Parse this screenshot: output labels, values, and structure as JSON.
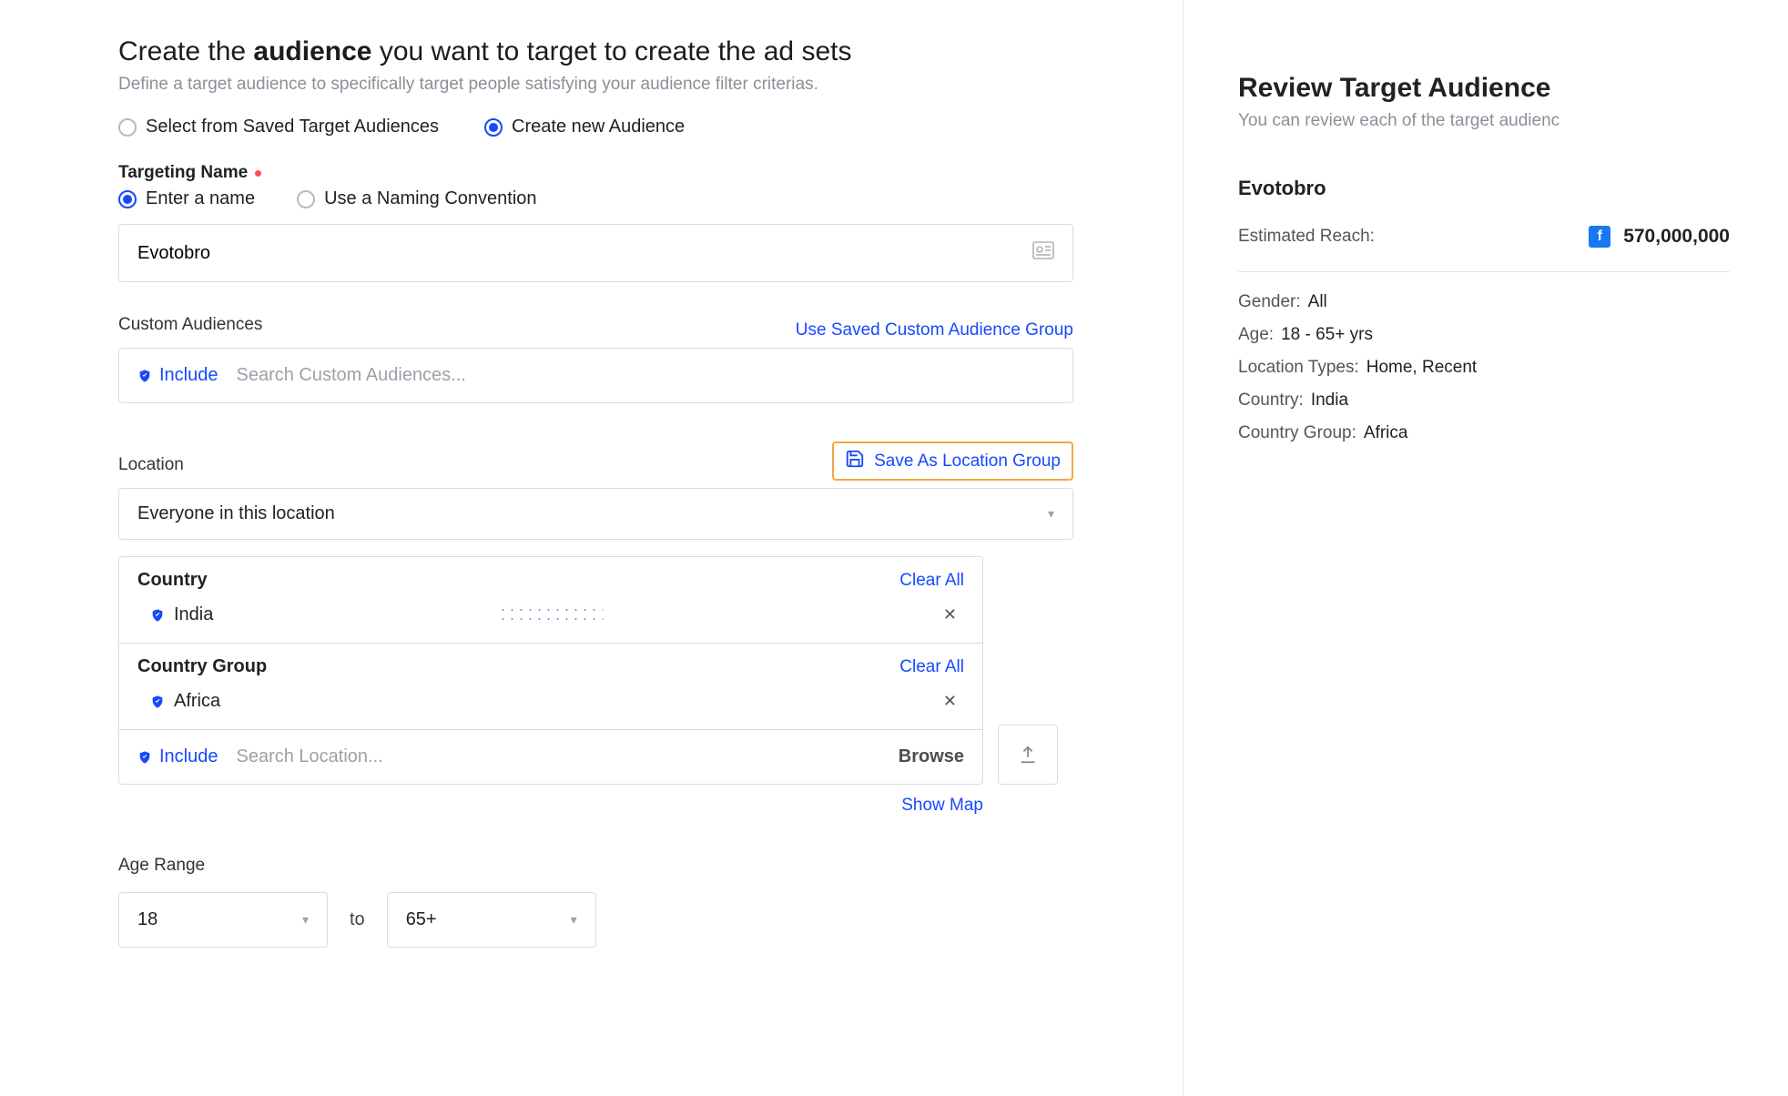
{
  "heading": {
    "prefix": "Create the ",
    "bold": "audience",
    "suffix": " you want to target to create the ad sets"
  },
  "subheading": "Define a target audience to specifically target people satisfying your audience filter criterias.",
  "source_radio": {
    "saved": "Select from Saved Target Audiences",
    "create": "Create new Audience"
  },
  "targeting_name": {
    "label": "Targeting Name",
    "enter": "Enter a name",
    "convention": "Use a Naming Convention",
    "value": "Evotobro"
  },
  "custom_audiences": {
    "label": "Custom Audiences",
    "saved_link": "Use Saved Custom Audience Group",
    "include": "Include",
    "placeholder": "Search Custom Audiences..."
  },
  "location": {
    "label": "Location",
    "save_group": "Save As Location Group",
    "scope": "Everyone in this location",
    "country_hdr": "Country",
    "country_group_hdr": "Country Group",
    "clear_all": "Clear All",
    "items": {
      "country": "India",
      "country_group": "Africa"
    },
    "include": "Include",
    "search_placeholder": "Search Location...",
    "browse": "Browse",
    "show_map": "Show Map"
  },
  "age": {
    "label": "Age Range",
    "from": "18",
    "to_word": "to",
    "to": "65+"
  },
  "review": {
    "title": "Review Target Audience",
    "sub": "You can review each of the target audienc",
    "name": "Evotobro",
    "reach_label": "Estimated Reach:",
    "reach_value": "570,000,000",
    "rows": {
      "gender_k": "Gender:",
      "gender_v": "All",
      "age_k": "Age:",
      "age_v": "18 - 65+ yrs",
      "loctype_k": "Location Types:",
      "loctype_v": "Home, Recent",
      "country_k": "Country:",
      "country_v": "India",
      "cg_k": "Country Group:",
      "cg_v": "Africa"
    }
  }
}
